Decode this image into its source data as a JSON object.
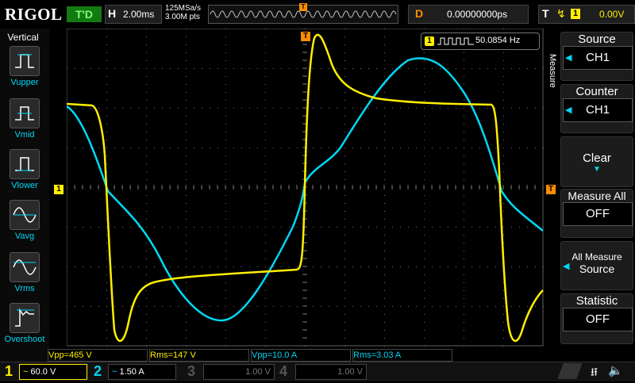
{
  "header": {
    "brand": "RIGOL",
    "run_state": "T'D",
    "timebase_key": "H",
    "timebase": "2.00ms",
    "sample_rate": "125MSa/s",
    "memory_depth": "3.00M pts",
    "delay_key": "D",
    "delay": "0.00000000ps",
    "trigger_key": "T",
    "trigger_source": "1",
    "trigger_level": "0.00V",
    "trigger_marker": "T"
  },
  "left_panel": {
    "title": "Vertical",
    "items": [
      {
        "label": "Vupper",
        "icon": "vupper-icon"
      },
      {
        "label": "Vmid",
        "icon": "vmid-icon"
      },
      {
        "label": "Vlower",
        "icon": "vlower-icon"
      },
      {
        "label": "Vavg",
        "icon": "vavg-icon"
      },
      {
        "label": "Vrms",
        "icon": "vrms-icon"
      },
      {
        "label": "Overshoot",
        "icon": "overshoot-icon"
      }
    ]
  },
  "right_panel": {
    "menu_title": "Measure",
    "sections": [
      {
        "heading": "Source",
        "value": "CH1"
      },
      {
        "heading": "Counter",
        "value": "CH1"
      },
      {
        "heading": "Clear",
        "value": ""
      },
      {
        "heading": "Measure All",
        "value": "OFF"
      },
      {
        "heading": "All Measure",
        "value": "Source"
      },
      {
        "heading": "Statistic",
        "value": "OFF"
      }
    ]
  },
  "counter": {
    "channel": "1",
    "frequency": "50.0854 Hz"
  },
  "markers": {
    "ch1_level": "1",
    "trigger_level": "T"
  },
  "measurements": [
    {
      "text": "Vpp=465 V",
      "color": "#FFEF00"
    },
    {
      "text": "Rms=147 V",
      "color": "#FFEF00"
    },
    {
      "text": "Vpp=10.0 A",
      "color": "#00D8F5"
    },
    {
      "text": "Rms=3.03 A",
      "color": "#00D8F5"
    }
  ],
  "channels": [
    {
      "number": "1",
      "coupling": "~",
      "scale": "60.0 V",
      "color": "#FFEF00",
      "active": true
    },
    {
      "number": "2",
      "coupling": "~",
      "scale": "1.50 A",
      "color": "#00D8F5",
      "active": true
    },
    {
      "number": "3",
      "coupling": "",
      "scale": "1.00 V",
      "color": "#555555",
      "active": false
    },
    {
      "number": "4",
      "coupling": "",
      "scale": "1.00 V",
      "color": "#555555",
      "active": false
    }
  ],
  "colors": {
    "ch1": "#FFEF00",
    "ch2": "#00D8F5",
    "trigger": "#FF8C00",
    "accent": "#00D8F5"
  }
}
